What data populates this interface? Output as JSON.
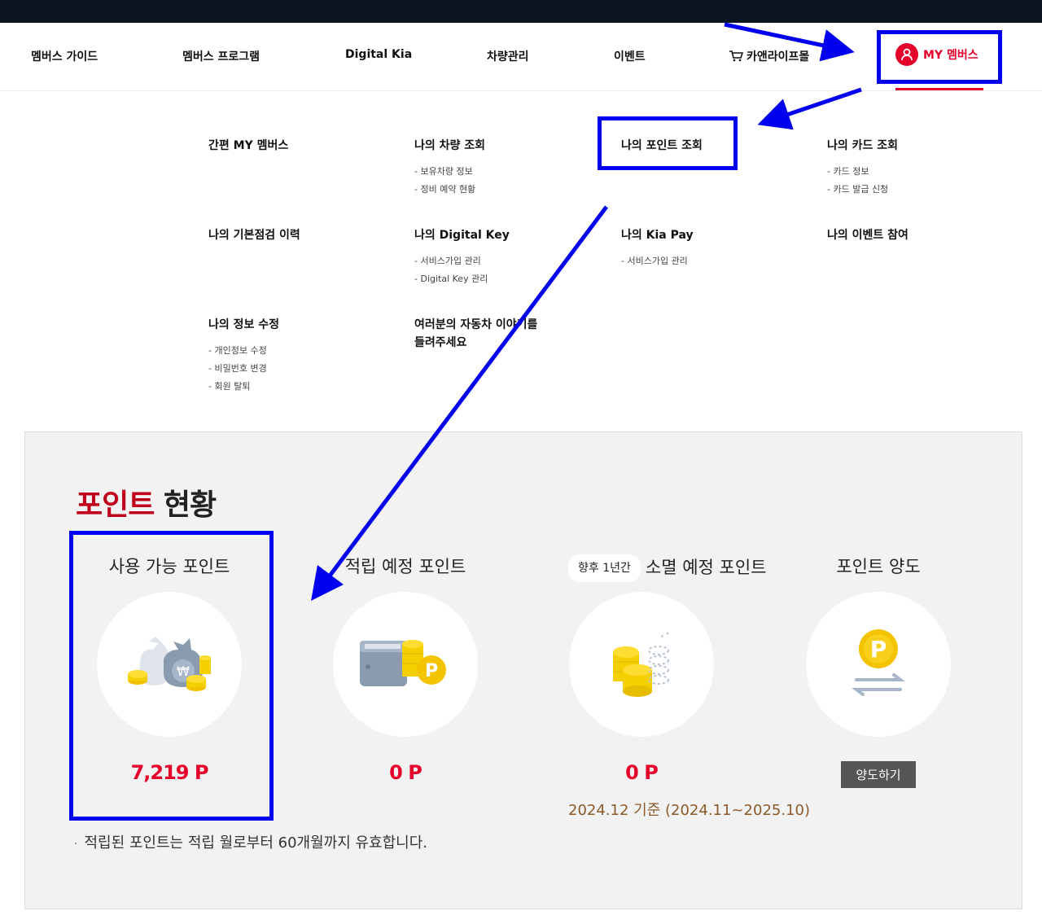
{
  "gnb": {
    "items": [
      "멤버스 가이드",
      "멤버스 프로그램",
      "Digital Kia",
      "차량관리",
      "이벤트",
      "카앤라이프몰"
    ],
    "my_label": "MY 멤버스"
  },
  "mega_menu": [
    {
      "title": "간편 MY 멤버스",
      "subs": []
    },
    {
      "title": "나의 차량 조회",
      "subs": [
        "보유차량 정보",
        "정비 예약 현황"
      ]
    },
    {
      "title": "나의 포인트 조회",
      "subs": []
    },
    {
      "title": "나의 카드 조회",
      "subs": [
        "카드 정보",
        "카드 발급 신청"
      ]
    },
    {
      "title": "나의 기본점검 이력",
      "subs": []
    },
    {
      "title": "나의 Digital Key",
      "subs": [
        "서비스가입 관리",
        "Digital Key 관리"
      ]
    },
    {
      "title": "나의 Kia Pay",
      "subs": [
        "서비스가입 관리"
      ]
    },
    {
      "title": "나의 이벤트 참여",
      "subs": []
    },
    {
      "title": "나의 정보 수정",
      "subs": [
        "개인정보 수정",
        "비밀번호 변경",
        "회원 탈퇴"
      ]
    },
    {
      "title": "여러분의 자동차 이야기를\n들려주세요",
      "subs": []
    }
  ],
  "points": {
    "heading_red": "포인트",
    "heading_dark": "현황",
    "available": {
      "title": "사용 가능 포인트",
      "value": "7,219 P"
    },
    "scheduled": {
      "title": "적립 예정 포인트",
      "value": "0 P"
    },
    "expiring": {
      "tag": "향후 1년간",
      "title": "소멸 예정 포인트",
      "value": "0 P",
      "period": "2024.12 기준 (2024.11~2025.10)"
    },
    "transfer": {
      "title": "포인트 양도",
      "button": "양도하기"
    },
    "notice": "적립된 포인트는 적립 월로부터 60개월까지 유효합니다."
  },
  "colors": {
    "accent": "#e4002b",
    "annotation": "#0000ee",
    "topbar": "#0c1621",
    "panel": "#f2f2f2"
  }
}
